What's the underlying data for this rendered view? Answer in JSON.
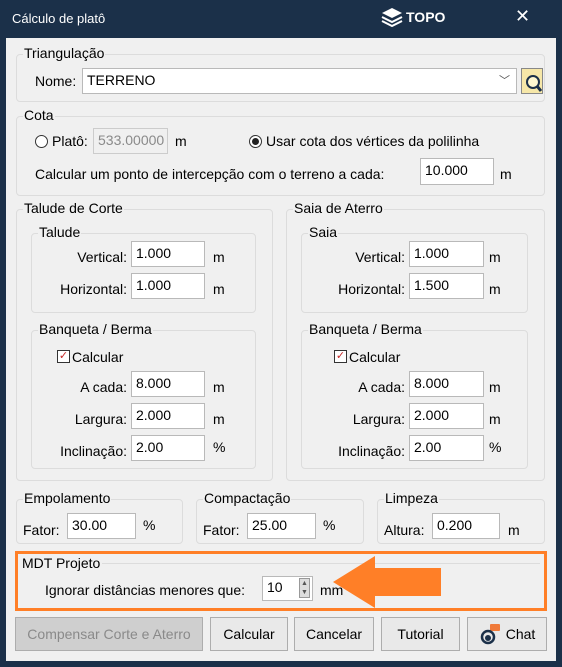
{
  "window": {
    "title": "Cálculo de platô",
    "brand": "TOPO",
    "close": "✕"
  },
  "triangulacao": {
    "legend": "Triangulação",
    "nome_label": "Nome:",
    "nome_value": "TERRENO"
  },
  "cota": {
    "legend": "Cota",
    "plato_label": "Platô:",
    "plato_value": "533.00000",
    "plato_unit": "m",
    "plato_selected": false,
    "usar_label": "Usar cota dos vértices da polilinha",
    "usar_selected": true,
    "intercep_label": "Calcular um ponto de intercepção com o terreno a cada:",
    "intercep_value": "10.000",
    "intercep_unit": "m"
  },
  "corte": {
    "legend": "Talude de Corte",
    "talude": {
      "legend": "Talude",
      "vertical_label": "Vertical:",
      "vertical": "1.000",
      "horizontal_label": "Horizontal:",
      "horizontal": "1.000",
      "unit": "m"
    },
    "banqueta": {
      "legend": "Banqueta / Berma",
      "calcular_label": "Calcular",
      "calcular_checked": true,
      "acada_label": "A cada:",
      "acada": "8.000",
      "largura_label": "Largura:",
      "largura": "2.000",
      "inclinacao_label": "Inclinação:",
      "inclinacao": "2.00",
      "unit": "m",
      "pct": "%"
    }
  },
  "aterro": {
    "legend": "Saia de Aterro",
    "talude": {
      "legend": "Saia",
      "vertical_label": "Vertical:",
      "vertical": "1.000",
      "horizontal_label": "Horizontal:",
      "horizontal": "1.500",
      "unit": "m"
    },
    "banqueta": {
      "legend": "Banqueta / Berma",
      "calcular_label": "Calcular",
      "calcular_checked": true,
      "acada_label": "A cada:",
      "acada": "8.000",
      "largura_label": "Largura:",
      "largura": "2.000",
      "inclinacao_label": "Inclinação:",
      "inclinacao": "2.00",
      "unit": "m",
      "pct": "%"
    }
  },
  "empolamento": {
    "legend": "Empolamento",
    "label": "Fator:",
    "value": "30.00",
    "unit": "%"
  },
  "compactacao": {
    "legend": "Compactação",
    "label": "Fator:",
    "value": "25.00",
    "unit": "%"
  },
  "limpeza": {
    "legend": "Limpeza",
    "label": "Altura:",
    "value": "0.200",
    "unit": "m"
  },
  "mdt": {
    "legend": "MDT Projeto",
    "label": "Ignorar distâncias menores que:",
    "value": "10",
    "unit": "mm",
    "highlight_color": "#ff7f27"
  },
  "buttons": {
    "compensar": "Compensar Corte e Aterro",
    "calcular": "Calcular",
    "cancelar": "Cancelar",
    "tutorial": "Tutorial",
    "chat": "Chat"
  }
}
